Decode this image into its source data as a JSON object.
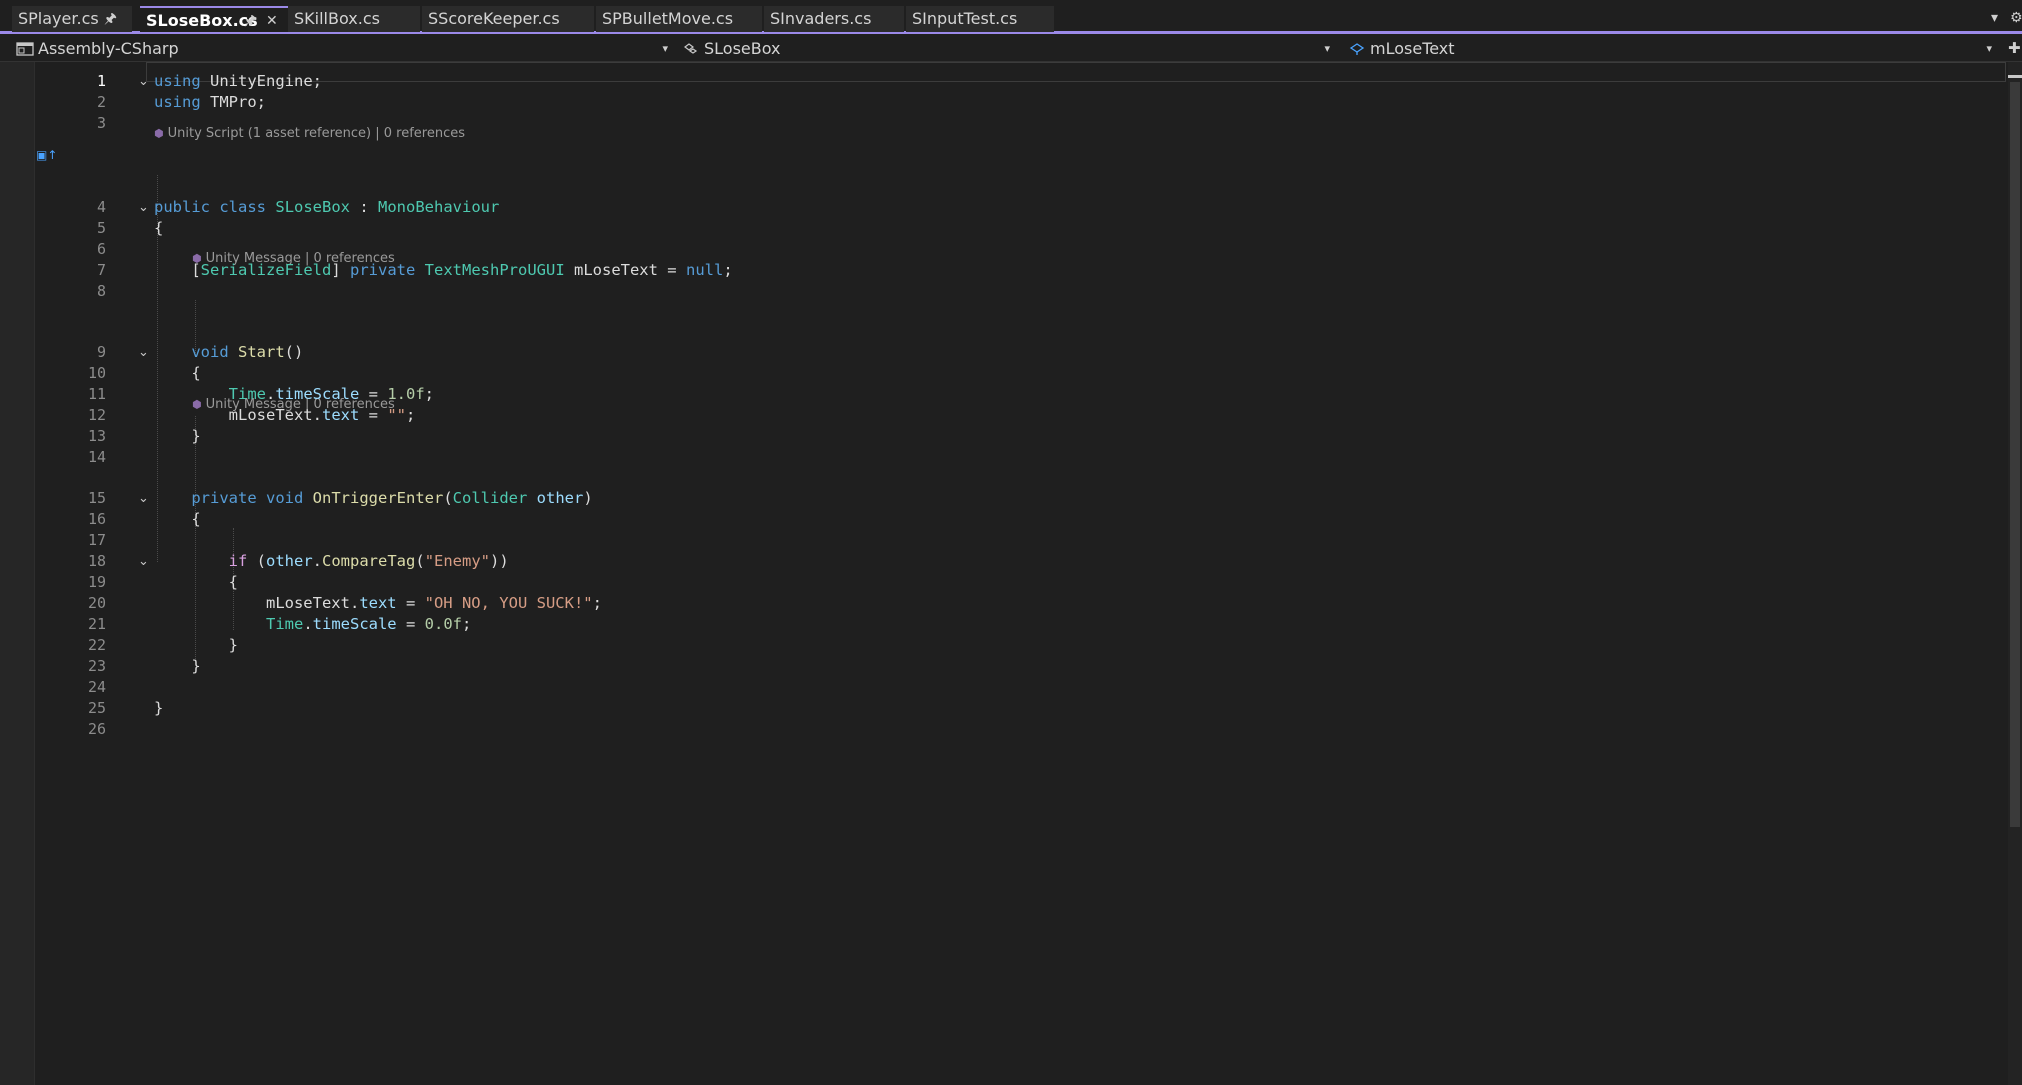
{
  "tabs": [
    {
      "label": "SPlayer.cs",
      "active": false,
      "pinned": true
    },
    {
      "label": "SLoseBox.cs",
      "active": true,
      "pinned": true
    },
    {
      "label": "SKillBox.cs",
      "active": false
    },
    {
      "label": "SScoreKeeper.cs",
      "active": false
    },
    {
      "label": "SPBulletMove.cs",
      "active": false
    },
    {
      "label": "SInvaders.cs",
      "active": false
    },
    {
      "label": "SInputTest.cs",
      "active": false
    }
  ],
  "navbar": {
    "project": "Assembly-CSharp",
    "type": "SLoseBox",
    "member": "mLoseText"
  },
  "codelens": {
    "script": "Unity Script (1 asset reference) | 0 references",
    "message_start": "Unity Message | 0 references",
    "message_trigger": "Unity Message | 0 references"
  },
  "lines": [
    {
      "n": "1",
      "tokens": [
        [
          "kw",
          "using"
        ],
        [
          "",
          " UnityEngine;"
        ]
      ]
    },
    {
      "n": "2",
      "tokens": [
        [
          "kw",
          "using"
        ],
        [
          "",
          " TMPro;"
        ]
      ]
    },
    {
      "n": "3",
      "tokens": []
    },
    {
      "n": "4",
      "tokens": [
        [
          "kw",
          "public"
        ],
        [
          "",
          " "
        ],
        [
          "kw",
          "class"
        ],
        [
          "",
          " "
        ],
        [
          "type",
          "SLoseBox"
        ],
        [
          "",
          " : "
        ],
        [
          "type",
          "MonoBehaviour"
        ]
      ]
    },
    {
      "n": "5",
      "tokens": [
        [
          "",
          "{"
        ]
      ]
    },
    {
      "n": "6",
      "tokens": []
    },
    {
      "n": "7",
      "tokens": [
        [
          "",
          "    ["
        ],
        [
          "attr",
          "SerializeField"
        ],
        [
          "",
          "] "
        ],
        [
          "kw",
          "private"
        ],
        [
          "",
          " "
        ],
        [
          "type",
          "TextMeshProUGUI"
        ],
        [
          "",
          " mLoseText = "
        ],
        [
          "kw",
          "null"
        ],
        [
          "",
          ";"
        ]
      ]
    },
    {
      "n": "8",
      "tokens": []
    },
    {
      "n": "9",
      "tokens": [
        [
          "",
          "    "
        ],
        [
          "kw",
          "void"
        ],
        [
          "",
          " "
        ],
        [
          "fn",
          "Start"
        ],
        [
          "",
          "()"
        ]
      ]
    },
    {
      "n": "10",
      "tokens": [
        [
          "",
          "    {"
        ]
      ]
    },
    {
      "n": "11",
      "tokens": [
        [
          "",
          "        "
        ],
        [
          "type",
          "Time"
        ],
        [
          "",
          "."
        ],
        [
          "var",
          "timeScale"
        ],
        [
          "",
          " = "
        ],
        [
          "num",
          "1.0f"
        ],
        [
          "",
          ";"
        ]
      ]
    },
    {
      "n": "12",
      "tokens": [
        [
          "",
          "        mLoseText."
        ],
        [
          "var",
          "text"
        ],
        [
          "",
          " = "
        ],
        [
          "str",
          "\"\""
        ],
        [
          "",
          ";"
        ]
      ]
    },
    {
      "n": "13",
      "tokens": [
        [
          "",
          "    }"
        ]
      ]
    },
    {
      "n": "14",
      "tokens": []
    },
    {
      "n": "15",
      "tokens": [
        [
          "",
          "    "
        ],
        [
          "kw",
          "private"
        ],
        [
          "",
          " "
        ],
        [
          "kw",
          "void"
        ],
        [
          "",
          " "
        ],
        [
          "fn",
          "OnTriggerEnter"
        ],
        [
          "",
          "("
        ],
        [
          "type",
          "Collider"
        ],
        [
          "",
          " "
        ],
        [
          "var",
          "other"
        ],
        [
          "",
          ")"
        ]
      ]
    },
    {
      "n": "16",
      "tokens": [
        [
          "",
          "    {"
        ]
      ]
    },
    {
      "n": "17",
      "tokens": []
    },
    {
      "n": "18",
      "tokens": [
        [
          "",
          "        "
        ],
        [
          "ctl",
          "if"
        ],
        [
          "",
          " ("
        ],
        [
          "var",
          "other"
        ],
        [
          "",
          "."
        ],
        [
          "fn",
          "CompareTag"
        ],
        [
          "",
          "("
        ],
        [
          "str",
          "\"Enemy\""
        ],
        [
          "",
          "))"
        ]
      ]
    },
    {
      "n": "19",
      "tokens": [
        [
          "",
          "        {"
        ]
      ]
    },
    {
      "n": "20",
      "tokens": [
        [
          "",
          "            mLoseText."
        ],
        [
          "var",
          "text"
        ],
        [
          "",
          " = "
        ],
        [
          "str",
          "\"OH NO, YOU SUCK!\""
        ],
        [
          "",
          ";"
        ]
      ]
    },
    {
      "n": "21",
      "tokens": [
        [
          "",
          "            "
        ],
        [
          "type",
          "Time"
        ],
        [
          "",
          "."
        ],
        [
          "var",
          "timeScale"
        ],
        [
          "",
          " = "
        ],
        [
          "num",
          "0.0f"
        ],
        [
          "",
          ";"
        ]
      ]
    },
    {
      "n": "22",
      "tokens": [
        [
          "",
          "        }"
        ]
      ]
    },
    {
      "n": "23",
      "tokens": [
        [
          "",
          "    }"
        ]
      ]
    },
    {
      "n": "24",
      "tokens": []
    },
    {
      "n": "25",
      "tokens": [
        [
          "",
          "}"
        ]
      ]
    },
    {
      "n": "26",
      "tokens": []
    }
  ],
  "colors": {
    "accent": "#9b89e8",
    "background": "#1f1f1f"
  }
}
